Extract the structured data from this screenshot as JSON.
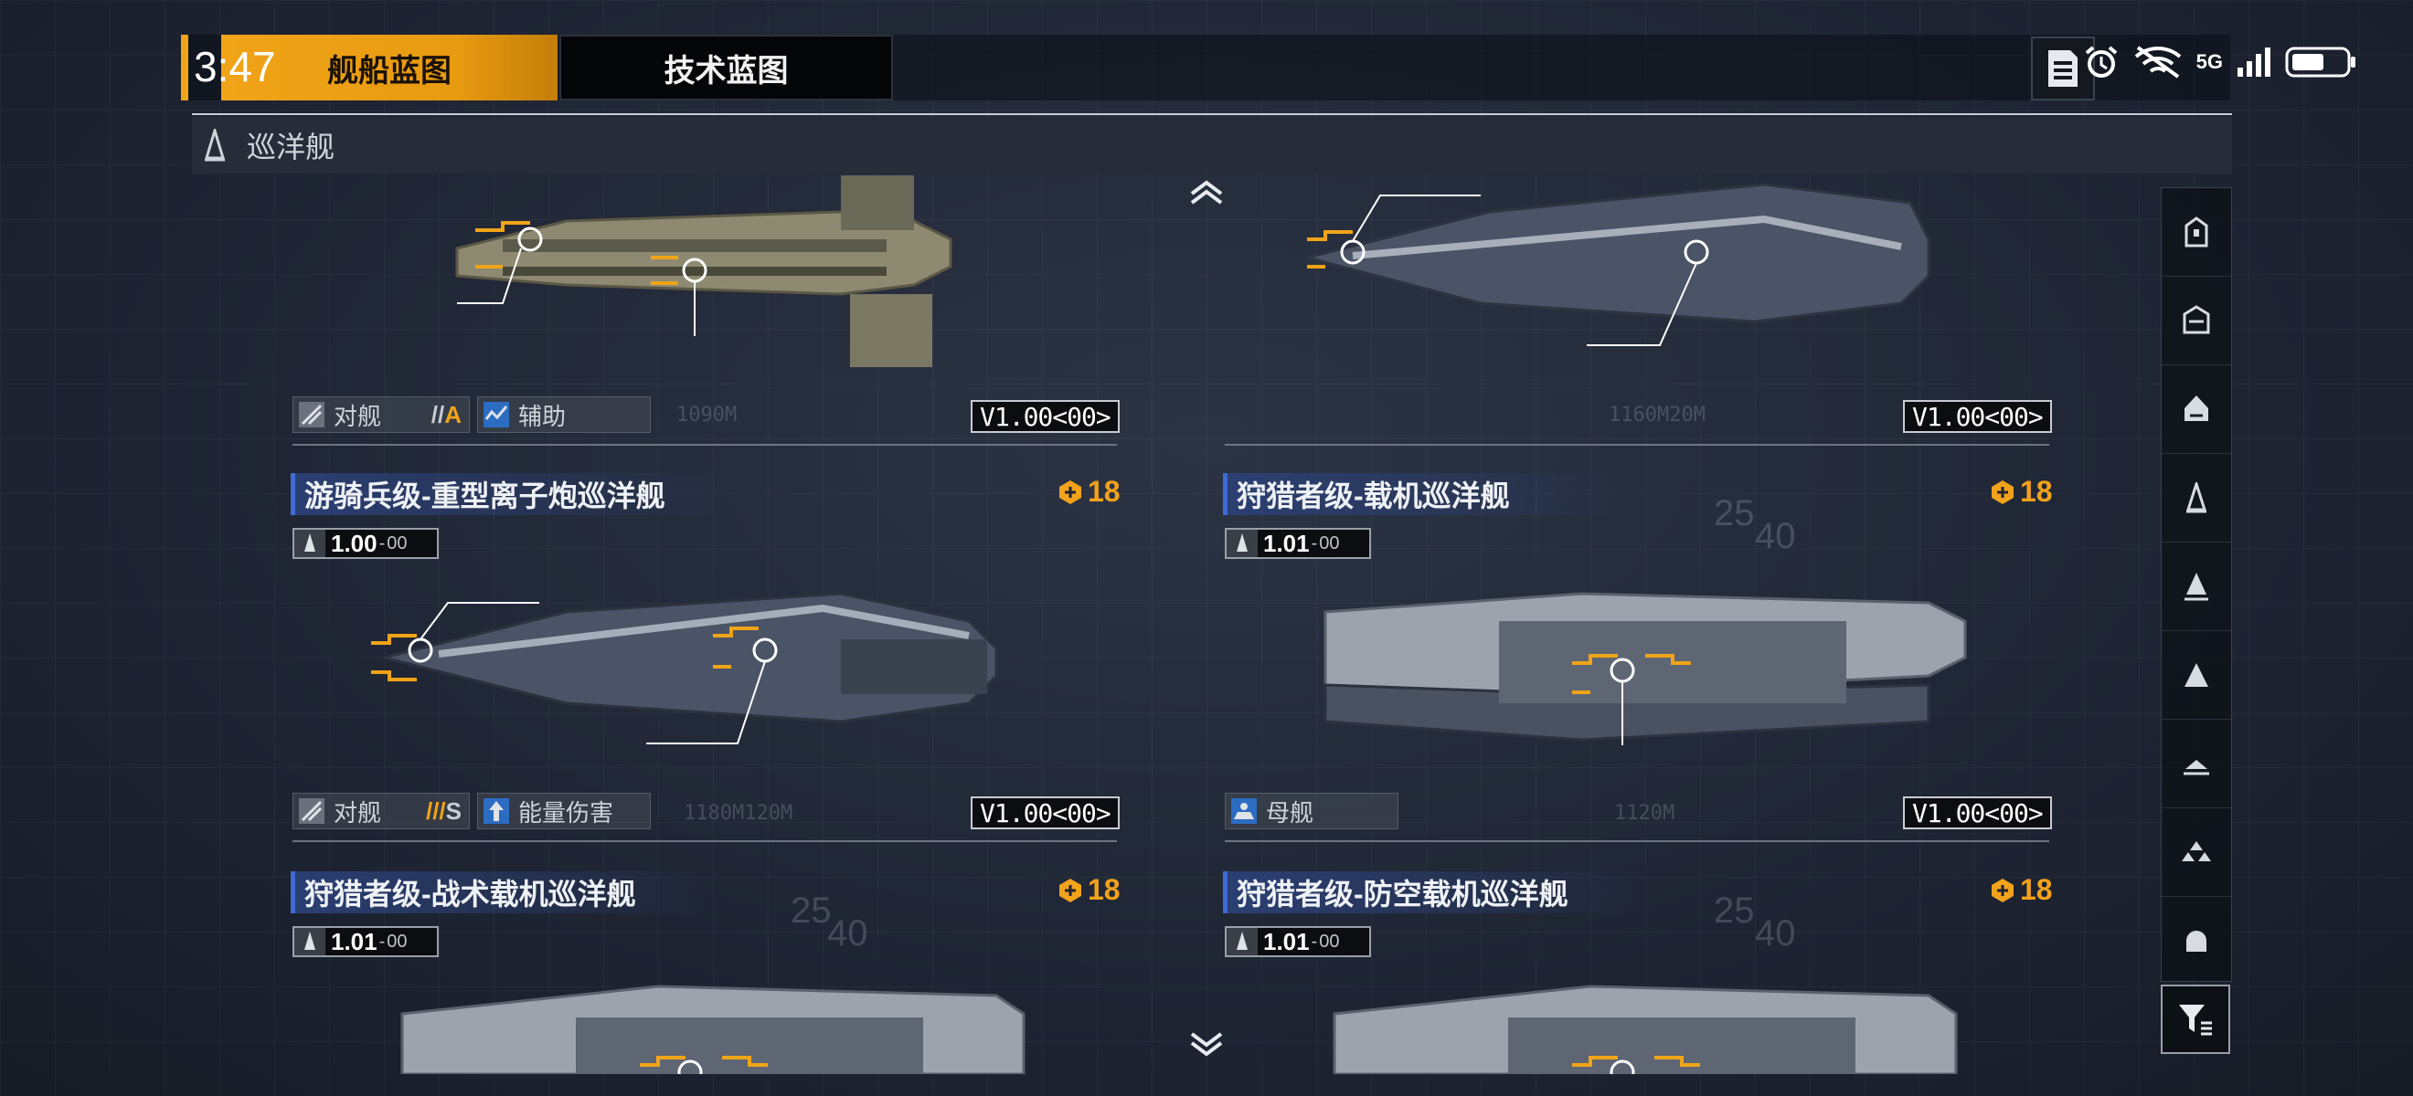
{
  "status_bar": {
    "time": "3:47",
    "network": "5G"
  },
  "tabs": [
    {
      "label": "舰船蓝图",
      "active": true
    },
    {
      "label": "技术蓝图",
      "active": false
    }
  ],
  "category": {
    "label": "巡洋舰"
  },
  "colors": {
    "accent": "#f0a418",
    "title_bar": "#2b3f73",
    "background": "#1e2430"
  },
  "top_cards": [
    {
      "tags": [
        {
          "label": "对舰",
          "grade": "A",
          "grade_marks": "//"
        },
        {
          "label": "辅助"
        }
      ],
      "version": "V1.00<00>"
    },
    {
      "tags": [],
      "version": "V1.00<00>"
    }
  ],
  "cards": [
    {
      "title": "游骑兵级-重型离子炮巡洋舰",
      "cost": "18",
      "ver_major": "1.00",
      "ver_minor": "00",
      "tags": [
        {
          "label": "对舰",
          "grade": "S",
          "grade_marks": "///"
        },
        {
          "label": "能量伤害"
        }
      ],
      "version": "V1.00<00>"
    },
    {
      "title": "狩猎者级-载机巡洋舰",
      "cost": "18",
      "ver_major": "1.01",
      "ver_minor": "00",
      "tags": [
        {
          "label": "母舰"
        }
      ],
      "version": "V1.00<00>"
    },
    {
      "title": "狩猎者级-战术载机巡洋舰",
      "cost": "18",
      "ver_major": "1.01",
      "ver_minor": "00"
    },
    {
      "title": "狩猎者级-防空载机巡洋舰",
      "cost": "18",
      "ver_major": "1.01",
      "ver_minor": "00"
    }
  ],
  "side_nav": [
    "frigate-icon",
    "destroyer-icon",
    "cruiser-icon",
    "cruiser-selected-icon",
    "battlecruiser-icon",
    "auxiliary-icon",
    "carrier-icon",
    "fighter-icon",
    "corvette-icon"
  ],
  "bg_text": {
    "d1": "1090M",
    "d2": "1160M20M",
    "d3": "1180M120M",
    "d4": "1120M",
    "t1": "25",
    "t2": "40"
  }
}
